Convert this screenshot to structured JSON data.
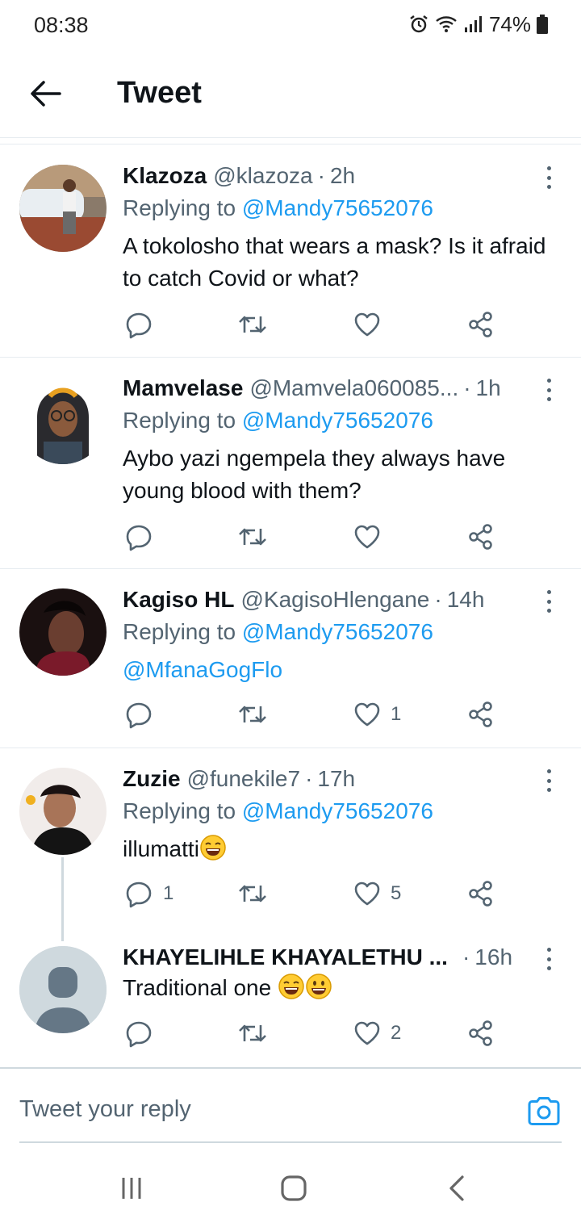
{
  "status_bar": {
    "time": "08:38",
    "battery": "74%"
  },
  "header": {
    "title": "Tweet"
  },
  "tweets": [
    {
      "name": "Klazoza",
      "handle": "@klazoza",
      "time": "2h",
      "replying_prefix": "Replying to",
      "replying_to": "@Mandy75652076",
      "text": "A tokolosho that wears a mask? Is it afraid to catch Covid or what?",
      "replies": "",
      "retweets": "",
      "likes": ""
    },
    {
      "name": "Mamvelase",
      "handle": "@Mamvela060085...",
      "time": "1h",
      "replying_prefix": "Replying to",
      "replying_to": "@Mandy75652076",
      "text": "Aybo yazi ngempela they always have young blood with them?",
      "replies": "",
      "retweets": "",
      "likes": ""
    },
    {
      "name": "Kagiso HL",
      "handle": "@KagisoHlengane",
      "time": "14h",
      "replying_prefix": "Replying to",
      "replying_to": "@Mandy75652076",
      "text": "@MfanaGogFlo",
      "replies": "",
      "retweets": "",
      "likes": "1"
    },
    {
      "name": "Zuzie",
      "handle": "@funekile7",
      "time": "17h",
      "replying_prefix": "Replying to",
      "replying_to": "@Mandy75652076",
      "text": "illumatti",
      "replies": "1",
      "retweets": "",
      "likes": "5"
    },
    {
      "name": "KHAYELIHLE KHAYALETHU ...",
      "handle": "",
      "time": "16h",
      "replying_prefix": "",
      "replying_to": "",
      "text": "Traditional one",
      "replies": "",
      "retweets": "",
      "likes": "2"
    }
  ],
  "composer": {
    "placeholder": "Tweet your reply"
  },
  "icons": {
    "reply": "reply-icon",
    "retweet": "retweet-icon",
    "like": "heart-icon",
    "share": "share-icon",
    "more": "more-icon"
  },
  "colors": {
    "accent": "#1d9bf0",
    "muted": "#536471"
  }
}
